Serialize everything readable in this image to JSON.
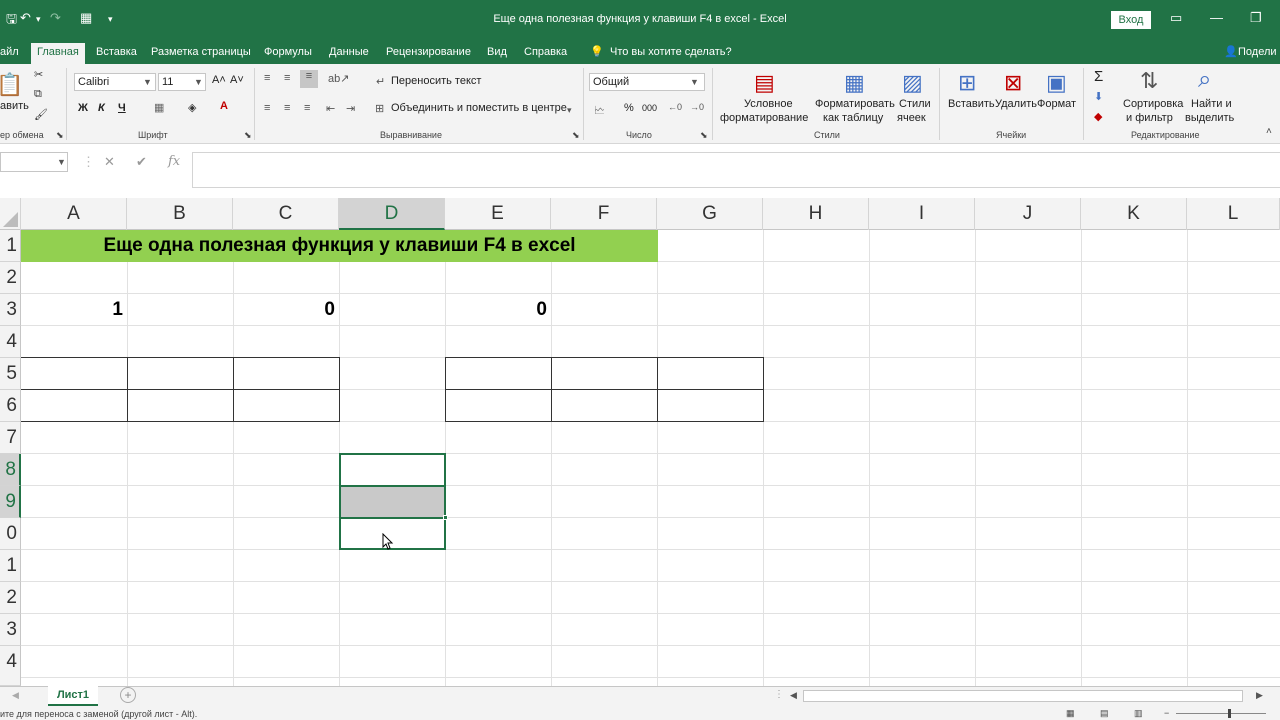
{
  "titlebar": {
    "title": "Еще одна полезная функция у клавиши F4 в excel  -  Excel",
    "login": "Вход",
    "colors": {
      "accent": "#217346"
    }
  },
  "menu": {
    "file": "айл",
    "items": [
      "Главная",
      "Вставка",
      "Разметка страницы",
      "Формулы",
      "Данные",
      "Рецензирование",
      "Вид",
      "Справка"
    ],
    "tell_me": "Что вы хотите сделать?",
    "share": "Подели"
  },
  "ribbon": {
    "clipboard": {
      "paste": "авить",
      "label": "ер обмена"
    },
    "font": {
      "name": "Calibri",
      "size": "11",
      "bold": "Ж",
      "italic": "К",
      "underline": "Ч",
      "label": "Шрифт"
    },
    "alignment": {
      "wrap": "Переносить текст",
      "merge": "Объединить и поместить в центре",
      "label": "Выравнивание"
    },
    "number": {
      "format": "Общий",
      "percent": "%",
      "thousands": "000",
      "label": "Число"
    },
    "styles": {
      "conditional": [
        "Условное",
        "форматирование"
      ],
      "as_table": [
        "Форматировать",
        "как таблицу"
      ],
      "cell_styles": [
        "Стили",
        "ячеек"
      ],
      "label": "Стили"
    },
    "cells": {
      "insert": "Вставить",
      "delete": "Удалить",
      "format": "Формат",
      "label": "Ячейки"
    },
    "editing": {
      "sort": [
        "Сортировка",
        "и фильтр"
      ],
      "find": [
        "Найти и",
        "выделить"
      ],
      "label": "Редактирование"
    }
  },
  "formula_bar": {
    "fx": "fx",
    "cancel": "✕",
    "enter": "✔",
    "value": ""
  },
  "grid": {
    "columns": [
      "A",
      "B",
      "C",
      "D",
      "E",
      "F",
      "G",
      "H",
      "I",
      "J",
      "K",
      "L"
    ],
    "selected_column": "D",
    "rows": [
      "1",
      "2",
      "3",
      "4",
      "5",
      "6",
      "7",
      "8",
      "9",
      "0",
      "1",
      "2",
      "3",
      "4"
    ],
    "title": "Еще одна полезная функция у клавиши F4 в excel",
    "values": {
      "A3": "1",
      "C3": "0",
      "E3": "0"
    }
  },
  "sheets": {
    "active": "Лист1",
    "add": "+"
  },
  "status": {
    "text": "ите для переноса с заменой (другой лист - Alt)."
  }
}
